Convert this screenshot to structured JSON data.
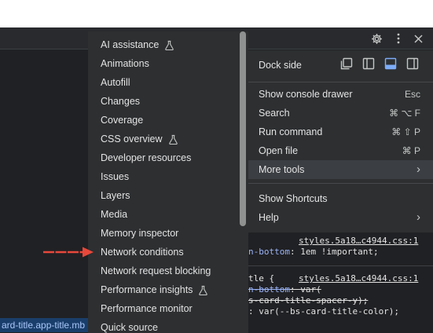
{
  "toolbar": {
    "icons": [
      "gear-icon",
      "kebab-icon",
      "close-icon"
    ]
  },
  "breadcrumb": "ard-title.app-title.mb",
  "tools_menu": {
    "items": [
      {
        "label": "AI assistance",
        "experimental": true
      },
      {
        "label": "Animations",
        "experimental": false
      },
      {
        "label": "Autofill",
        "experimental": false
      },
      {
        "label": "Changes",
        "experimental": false
      },
      {
        "label": "Coverage",
        "experimental": false
      },
      {
        "label": "CSS overview",
        "experimental": true
      },
      {
        "label": "Developer resources",
        "experimental": false
      },
      {
        "label": "Issues",
        "experimental": false
      },
      {
        "label": "Layers",
        "experimental": false
      },
      {
        "label": "Media",
        "experimental": false
      },
      {
        "label": "Memory inspector",
        "experimental": false
      },
      {
        "label": "Network conditions",
        "experimental": false
      },
      {
        "label": "Network request blocking",
        "experimental": false
      },
      {
        "label": "Performance insights",
        "experimental": true
      },
      {
        "label": "Performance monitor",
        "experimental": false
      },
      {
        "label": "Quick source",
        "experimental": false
      }
    ]
  },
  "settings_menu": {
    "dock_side_label": "Dock side",
    "dock_icons": [
      "undock-icon",
      "dock-left-icon",
      "dock-bottom-icon",
      "dock-right-icon"
    ],
    "selected_dock": "dock-bottom-icon",
    "items": [
      {
        "label": "Show console drawer",
        "shortcut": "Esc"
      },
      {
        "label": "Search",
        "shortcut": "⌘ ⌥ F"
      },
      {
        "label": "Run command",
        "shortcut": "⌘ ⇧ P"
      },
      {
        "label": "Open file",
        "shortcut": "⌘ P"
      },
      {
        "label": "More tools",
        "shortcut": "›"
      }
    ],
    "items2": [
      {
        "label": "Show Shortcuts",
        "shortcut": ""
      },
      {
        "label": "Help",
        "shortcut": "›"
      }
    ]
  },
  "styles_pane": {
    "link1": "styles.5a18…c4944.css:1",
    "line1a": "n-bottom",
    "line1b": ": 1em !important;",
    "selector2": "tle {",
    "link2": "styles.5a18…c4944.css:1",
    "line2a": "n-bottom",
    "line2b": ": var(",
    "line3": "s-card-title-spacer-y);",
    "line4": ": var(--bs-card-title-color);"
  },
  "colors": {
    "accent": "#7cacf8",
    "menu_bg": "#2d2f31",
    "highlight": "#3b3e42",
    "arrow": "#e8483a"
  }
}
